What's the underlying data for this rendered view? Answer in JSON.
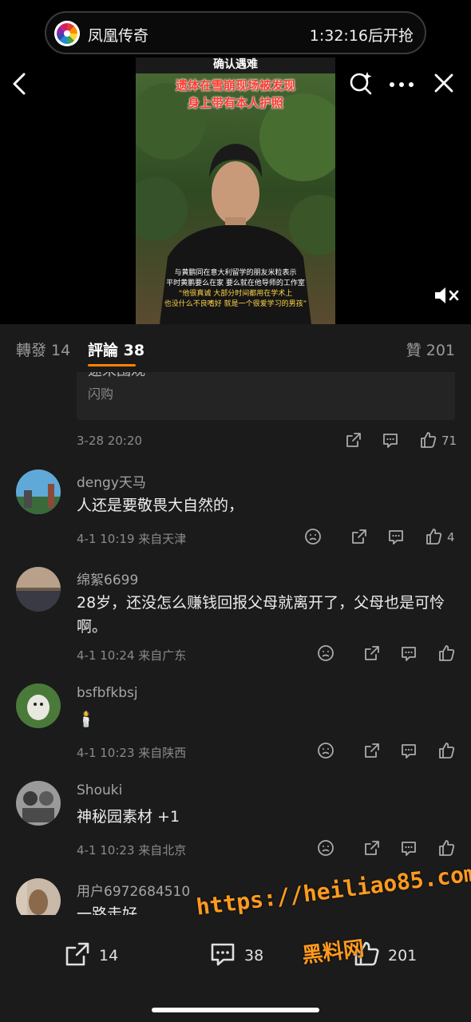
{
  "top_pill": {
    "app_name": "凤凰传奇",
    "countdown": "1:32:16后开抢"
  },
  "video": {
    "title": "确认遇难",
    "headline_line1": "遗体在雪崩现场被发现",
    "headline_line2": "身上带有本人护照",
    "caption_line1": "与黄鹏同在意大利留学的朋友米粒表示",
    "caption_line2": "平时黄鹏要么在家 要么就在他导师的工作室",
    "caption_line3": "“他很真诚 大部分时间都用在学术上",
    "caption_line4": "也没什么不良嗜好 就是一个很爱学习的男孩”"
  },
  "tabs": {
    "repost": "轉發 14",
    "comments": "評論 38",
    "likes": "贊 201"
  },
  "quoted": {
    "text": "速来围观",
    "source": "闪购"
  },
  "first_item": {
    "time": "3-28 20:20",
    "likes": "71"
  },
  "comments": [
    {
      "name": "dengy天马",
      "text": "人还是要敬畏大自然的，",
      "meta": "4-1 10:19  来自天津",
      "likes": "4"
    },
    {
      "name": "绵絮6699",
      "text": "28岁，还没怎么赚钱回报父母就离开了，父母也是可怜啊。",
      "meta": "4-1 10:24  来自广东",
      "likes": ""
    },
    {
      "name": "bsfbfkbsj",
      "text": "🕯️",
      "meta": "4-1 10:23  来自陕西",
      "likes": ""
    },
    {
      "name": "Shouki",
      "text": "神秘园素材 +1",
      "meta": "4-1 10:23  来自北京",
      "likes": ""
    },
    {
      "name": "用户6972684510",
      "text": "一路走好",
      "meta": "",
      "likes": ""
    }
  ],
  "bottom_bar": {
    "repost_count": "14",
    "comment_count": "38",
    "like_count": "201"
  },
  "watermark": {
    "url": "https://heiliao85.com",
    "name": "黑料网"
  },
  "colors": {
    "accent": "#ff8200",
    "background": "#1b1b1b"
  }
}
